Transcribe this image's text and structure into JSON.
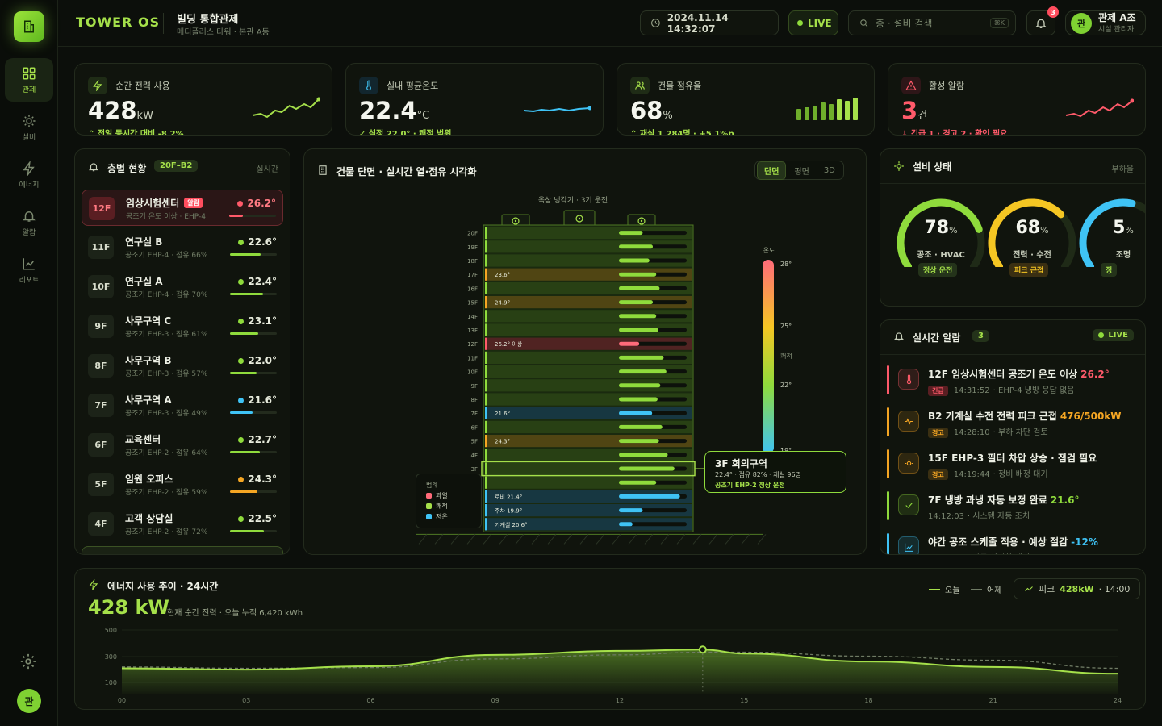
{
  "brand": "TOWER OS",
  "header": {
    "title": "빌딩 통합관제",
    "subtitle": "메디플러스 타워 · 본관 A동",
    "datetime": "2024.11.14 14:32:07",
    "live": "LIVE",
    "search_placeholder": "층 · 설비 검색",
    "shortcut": "⌘K",
    "notif_count": "3",
    "user_initial": "관",
    "user_name": "관제 A조",
    "user_role": "시설 관리자"
  },
  "nav": [
    {
      "label": "관제",
      "icon": "grid-icon"
    },
    {
      "label": "설비",
      "icon": "sun-icon"
    },
    {
      "label": "에너지",
      "icon": "bolt-icon"
    },
    {
      "label": "알람",
      "icon": "bell-icon"
    },
    {
      "label": "리포트",
      "icon": "chart-line-icon"
    }
  ],
  "kpis": [
    {
      "label": "순간 전력 사용",
      "value": "428",
      "unit": "kW",
      "sub": "⌃ 전일 동시간 대비 -8.2%",
      "color": "#a5e04a",
      "icon": "bolt-icon"
    },
    {
      "label": "실내 평균온도",
      "value": "22.4",
      "unit": "°C",
      "sub": "✓ 설정 22.0° · 쾌적 범위",
      "color": "#3fc3f5",
      "icon": "thermometer-icon"
    },
    {
      "label": "건물 점유율",
      "value": "68",
      "unit": "%",
      "sub": "⌃ 재실 1,284명 · +5.1%p",
      "color": "#a5e04a",
      "icon": "users-icon"
    },
    {
      "label": "활성 알람",
      "value": "3",
      "unit": "건",
      "sub": "↓ 긴급 1 · 경고 2 · 확인 필요",
      "color": "#ff5a6a",
      "icon": "warning-icon"
    }
  ],
  "floor_panel": {
    "title": "층별 현황",
    "range": "20F–B2",
    "mode": "실시간",
    "alarm_tag": "알람"
  },
  "floors": [
    {
      "floor": "12F",
      "name": "임상시험센터",
      "desc": "공조기 온도 이상 · EHP-4",
      "temp": "26.2°",
      "color": "#ff5a6a",
      "fill": 0.3,
      "alarm": true
    },
    {
      "floor": "11F",
      "name": "연구실 B",
      "desc": "공조기 EHP-4 · 점유 66%",
      "temp": "22.6°",
      "color": "#8fdb3c",
      "fill": 0.66
    },
    {
      "floor": "10F",
      "name": "연구실 A",
      "desc": "공조기 EHP-4 · 점유 70%",
      "temp": "22.4°",
      "color": "#8fdb3c",
      "fill": 0.7
    },
    {
      "floor": "9F",
      "name": "사무구역 C",
      "desc": "공조기 EHP-3 · 점유 61%",
      "temp": "23.1°",
      "color": "#8fdb3c",
      "fill": 0.61
    },
    {
      "floor": "8F",
      "name": "사무구역 B",
      "desc": "공조기 EHP-3 · 점유 57%",
      "temp": "22.0°",
      "color": "#8fdb3c",
      "fill": 0.57
    },
    {
      "floor": "7F",
      "name": "사무구역 A",
      "desc": "공조기 EHP-3 · 점유 49%",
      "temp": "21.6°",
      "color": "#3fc3f5",
      "fill": 0.49
    },
    {
      "floor": "6F",
      "name": "교육센터",
      "desc": "공조기 EHP-2 · 점유 64%",
      "temp": "22.7°",
      "color": "#8fdb3c",
      "fill": 0.64
    },
    {
      "floor": "5F",
      "name": "임원 오피스",
      "desc": "공조기 EHP-2 · 점유 59%",
      "temp": "24.3°",
      "color": "#f5a623",
      "fill": 0.59
    },
    {
      "floor": "4F",
      "name": "고객 상담실",
      "desc": "공조기 EHP-2 · 점유 72%",
      "temp": "22.5°",
      "color": "#8fdb3c",
      "fill": 0.72
    }
  ],
  "building": {
    "title": "건물 단면 · 실시간 열·점유 시각화",
    "tabs": [
      "단면",
      "평면",
      "3D"
    ],
    "roof": "옥상 냉각기 · 3기 운전",
    "levels": [
      "20F",
      "19F",
      "18F",
      "17F",
      "16F",
      "15F",
      "14F",
      "13F",
      "12F",
      "11F",
      "10F",
      "9F",
      "8F",
      "7F",
      "6F",
      "5F",
      "4F",
      "3F",
      "2F",
      "1F",
      "B1",
      "B2"
    ],
    "occupancy": [
      0.35,
      0.5,
      0.45,
      0.55,
      0.6,
      0.5,
      0.55,
      0.58,
      0.3,
      0.66,
      0.7,
      0.61,
      0.57,
      0.49,
      0.64,
      0.59,
      0.72,
      0.82,
      0.55,
      0.9,
      0.35,
      0.2
    ],
    "status": [
      "n",
      "n",
      "n",
      "w",
      "n",
      "w",
      "n",
      "n",
      "a",
      "n",
      "n",
      "n",
      "n",
      "c",
      "n",
      "w",
      "n",
      "s",
      "n",
      "c",
      "c",
      "c"
    ],
    "labels": {
      "17F": "23.6°",
      "15F": "24.9°",
      "12F": "26.2° 이상",
      "7F": "21.6°",
      "5F": "24.3°",
      "1F": "로비 21.4°",
      "B1": "주차 19.9°",
      "B2": "기계실 20.6°"
    },
    "temp_scale_title": "온도",
    "temp_ticks": [
      "28°",
      "25°",
      "쾌적",
      "22°",
      "19°"
    ],
    "legend_title": "범례",
    "legend": [
      {
        "label": "과열",
        "color": "#ff6b7a"
      },
      {
        "label": "쾌적",
        "color": "#a5e04a"
      },
      {
        "label": "저온",
        "color": "#3fc3f5"
      }
    ],
    "tooltip": {
      "title": "3F 회의구역",
      "line1": "22.4° · 점유 82% · 재실 96명",
      "line2": "공조기 EHP-2 정상 운전"
    }
  },
  "equipment": {
    "title": "설비 상태",
    "mode": "부하율",
    "items": [
      {
        "value": "78",
        "label": "공조 · HVAC",
        "status": "정상 운전",
        "color": "#8fdb3c",
        "pct": 0.78
      },
      {
        "value": "68",
        "label": "전력 · 수전",
        "status": "피크 근접",
        "color": "#f5c623",
        "pct": 0.68
      },
      {
        "value": "5",
        "label": "조명",
        "status": "정",
        "color": "#3fc3f5",
        "pct": 0.55
      }
    ]
  },
  "alerts": {
    "title": "실시간 알람",
    "count": "3",
    "live": "LIVE",
    "items": [
      {
        "title": "12F 임상시험센터 공조기 온도 이상",
        "value": "26.2°",
        "sev": "긴급",
        "time": "14:31:52",
        "note": "· EHP-4 냉방 응답 없음",
        "color": "#ff5a6a",
        "icon": "thermometer-icon"
      },
      {
        "title": "B2 기계실 수전 전력 피크 근접",
        "value": "476/500kW",
        "sev": "경고",
        "time": "14:28:10",
        "note": "· 부하 차단 검토",
        "color": "#f5a623",
        "icon": "pulse-icon"
      },
      {
        "title": "15F EHP-3 필터 차압 상승 · 점검 필요",
        "value": "",
        "sev": "경고",
        "time": "14:19:44",
        "note": "· 정비 배정 대기",
        "color": "#f5a623",
        "icon": "crosshair-icon"
      },
      {
        "title": "7F 냉방 과냉 자동 보정 완료",
        "value": "21.6°",
        "sev": "",
        "time": "14:12:03",
        "note": "· 시스템 자동 조치",
        "color": "#8fdb3c",
        "icon": "check-icon"
      },
      {
        "title": "야간 공조 스케줄 적용 · 예상 절감",
        "value": "-12%",
        "sev": "",
        "time": "14:00:00",
        "note": "· 자동 최적화 엔진",
        "color": "#3fc3f5",
        "icon": "chart-icon"
      }
    ]
  },
  "energy": {
    "title": "에너지 사용 추이 · 24시간",
    "value": "428 kW",
    "sub": "현재 순간 전력 · 오늘 누적 6,420 kWh",
    "legend_today": "오늘",
    "legend_yesterday": "어제",
    "peak": "피크",
    "peak_value": "428kW",
    "peak_time": "· 14:00"
  },
  "chart_data": {
    "type": "area",
    "title": "에너지 사용 추이 · 24시간",
    "x": [
      0,
      3,
      6,
      9,
      12,
      14,
      15,
      18,
      21,
      24
    ],
    "xticks": [
      "00",
      "03",
      "06",
      "09",
      "12",
      "15",
      "18",
      "21",
      "24"
    ],
    "yticks": [
      "500",
      "300",
      "100"
    ],
    "ylim": [
      0,
      500
    ],
    "series": [
      {
        "name": "오늘",
        "values": [
          190,
          180,
          205,
          290,
          320,
          330,
          300,
          240,
          200,
          150
        ]
      },
      {
        "name": "어제",
        "values": [
          200,
          190,
          195,
          260,
          290,
          310,
          310,
          280,
          250,
          190
        ]
      }
    ]
  }
}
